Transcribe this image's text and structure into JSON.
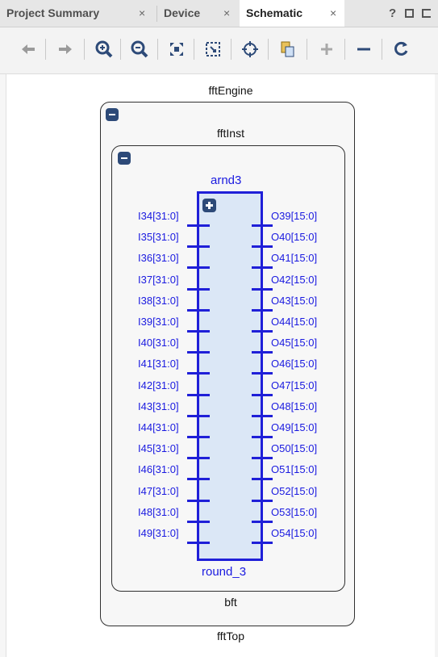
{
  "tabs": [
    {
      "label": "Project Summary",
      "close": "×"
    },
    {
      "label": "Device",
      "close": "×"
    },
    {
      "label": "Schematic",
      "close": "×"
    }
  ],
  "window_controls": {
    "help": "?"
  },
  "toolbar": {
    "buttons": [
      "back-icon",
      "forward-icon",
      "zoom-in-icon",
      "zoom-out-icon",
      "zoom-fit-icon",
      "zoom-area-icon",
      "crosshair-icon",
      "select-icon",
      "add-icon",
      "remove-icon",
      "refresh-icon"
    ]
  },
  "schematic": {
    "top_title": "fftEngine",
    "inner_title": "fftInst",
    "block_top": "arnd3",
    "block_bottom": "round_3",
    "inner_footer": "bft",
    "outer_footer": "fftTop",
    "inputs": [
      "I34[31:0]",
      "I35[31:0]",
      "I36[31:0]",
      "I37[31:0]",
      "I38[31:0]",
      "I39[31:0]",
      "I40[31:0]",
      "I41[31:0]",
      "I42[31:0]",
      "I43[31:0]",
      "I44[31:0]",
      "I45[31:0]",
      "I46[31:0]",
      "I47[31:0]",
      "I48[31:0]",
      "I49[31:0]"
    ],
    "outputs": [
      "O39[15:0]",
      "O40[15:0]",
      "O41[15:0]",
      "O42[15:0]",
      "O43[15:0]",
      "O44[15:0]",
      "O45[15:0]",
      "O46[15:0]",
      "O47[15:0]",
      "O48[15:0]",
      "O49[15:0]",
      "O50[15:0]",
      "O51[15:0]",
      "O52[15:0]",
      "O53[15:0]",
      "O54[15:0]"
    ]
  },
  "colors": {
    "net": "#1f1fd8",
    "cell_fill": "#dbe7f6",
    "button": "#2d4a78"
  }
}
